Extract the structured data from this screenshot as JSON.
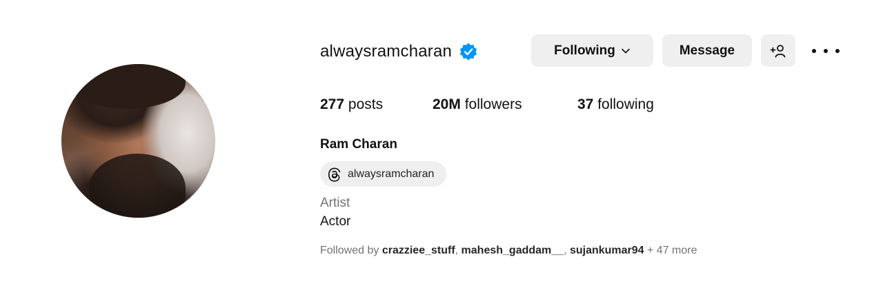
{
  "profile": {
    "username": "alwaysramcharan",
    "full_name": "Ram Charan",
    "category": "Artist",
    "bio": "Actor",
    "threads_handle": "alwaysramcharan"
  },
  "actions": {
    "following_label": "Following",
    "message_label": "Message"
  },
  "stats": {
    "posts_count": "277",
    "posts_label": "posts",
    "followers_count": "20M",
    "followers_label": "followers",
    "following_count": "37",
    "following_label": "following"
  },
  "followed_by": {
    "prefix": "Followed by",
    "accounts": [
      "crazziee_stuff",
      "mahesh_gaddam__",
      "sujankumar94"
    ],
    "more": "+ 47 more"
  },
  "icons": {
    "verified": "verified-badge-icon",
    "chevron": "chevron-down-icon",
    "add_user": "add-user-icon",
    "more": "more-options-icon",
    "threads": "threads-icon"
  },
  "colors": {
    "verified_blue": "#0095f6",
    "button_bg": "#efefef",
    "secondary_text": "#737373"
  }
}
